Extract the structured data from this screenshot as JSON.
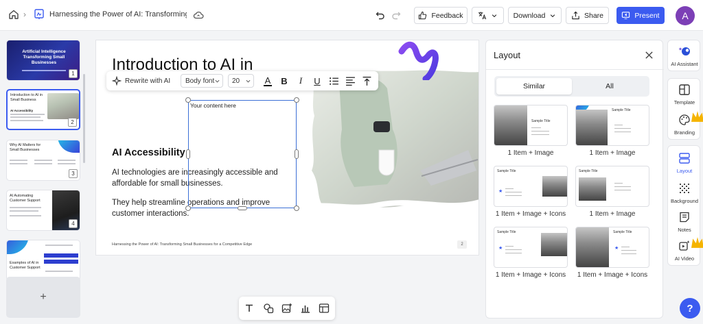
{
  "header": {
    "doc_title": "Harnessing the Power of AI: Transforming S...",
    "feedback_label": "Feedback",
    "download_label": "Download",
    "share_label": "Share",
    "present_label": "Present",
    "avatar_initial": "A",
    "accent_color": "#3b5bf0"
  },
  "thumbnails": [
    {
      "number": "1",
      "title": "Artificial Intelligence Transforming Small Businesses"
    },
    {
      "number": "2",
      "title": "Introduction to AI in Small Business",
      "subtitle": "AI Accessibility"
    },
    {
      "number": "3",
      "title": "Why AI Matters for Small Businesses"
    },
    {
      "number": "4",
      "title": "AI Automating Customer Support"
    },
    {
      "number": "",
      "title": "Examples of AI in Customer Support"
    }
  ],
  "add_slide_label": "+",
  "slide": {
    "heading": "Introduction to AI in",
    "section_heading": "AI Accessibility",
    "paragraph1": "AI technologies are increasingly accessible and affordable for small businesses.",
    "paragraph2": "They help streamline operations and improve customer interactions.",
    "textbox_content": "Your content here",
    "footer": "Harnessing the Power of AI: Transforming Small Businesses for a Competitive Edge",
    "page_number": "2"
  },
  "text_toolbar": {
    "rewrite_label": "Rewrite with AI",
    "font": "Body font",
    "size": "20",
    "bold": "B",
    "italic": "I",
    "underline": "U",
    "text_color_letter": "A"
  },
  "layout_panel": {
    "title": "Layout",
    "tabs": [
      "Similar",
      "All"
    ],
    "active_tab": "Similar",
    "card_sample_title": "Sample Title",
    "cards": [
      {
        "label": "1 Item + Image"
      },
      {
        "label": "1 Item + Image"
      },
      {
        "label": "1 Item + Image + Icons"
      },
      {
        "label": "1 Item + Image"
      },
      {
        "label": "1 Item + Image + Icons"
      },
      {
        "label": "1 Item + Image + Icons"
      }
    ]
  },
  "rail": {
    "ai_assistant": "AI Assistant",
    "template": "Template",
    "branding": "Branding",
    "layout": "Layout",
    "background": "Background",
    "notes": "Notes",
    "ai_video": "AI Video"
  },
  "help_label": "?"
}
